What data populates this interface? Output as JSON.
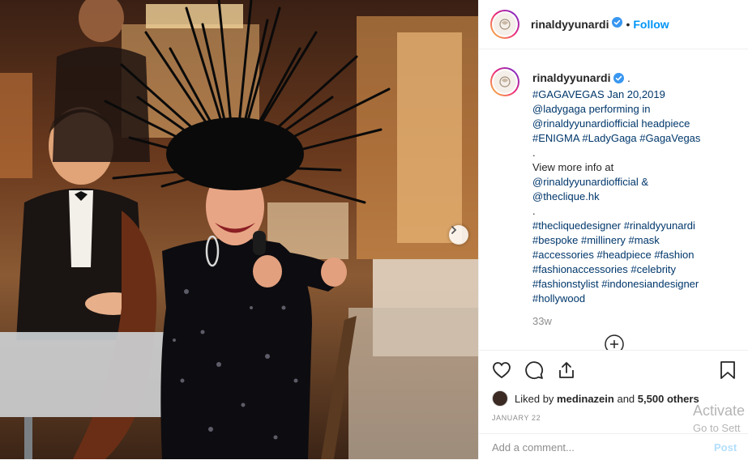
{
  "post": {
    "username": "rinaldyyunardi",
    "follow_label": "Follow",
    "dot": "•",
    "caption": {
      "user": "rinaldyyunardi",
      "lines": [
        " .",
        "#GAGAVEGAS Jan 20,2019",
        "@ladygaga performing in",
        "@rinaldyyunardiofficial headpiece",
        "#ENIGMA #LadyGaga #GagaVegas",
        ".",
        "View more info at",
        "@rinaldyyunardiofficial &",
        "@theclique.hk",
        ".",
        "#thecliquedesigner #rinaldyyunardi",
        "#bespoke #millinery #mask",
        "#accessories #headpiece #fashion",
        "#fashionaccessories #celebrity",
        "#fashionstylist #indonesiandesigner",
        "#hollywood"
      ]
    },
    "time_ago": "33w",
    "likes": {
      "prefix": "Liked by",
      "user": "medinazein",
      "and": "and",
      "count": "5,500 others"
    },
    "date": "JANUARY 22",
    "comment": {
      "placeholder": "Add a comment...",
      "post_label": "Post"
    }
  },
  "icons": {
    "verified": "verified-badge-icon",
    "like": "heart-icon",
    "comment": "comment-bubble-icon",
    "share": "share-icon",
    "save": "bookmark-icon",
    "next": "chevron-right-icon",
    "more": "plus-circle-icon"
  },
  "watermark": {
    "line1": "Activate",
    "line2": "Go to Sett"
  },
  "colors": {
    "accent": "#0095f6",
    "verified": "#3897f0",
    "link": "#00376b",
    "muted": "#8e8e8e"
  }
}
